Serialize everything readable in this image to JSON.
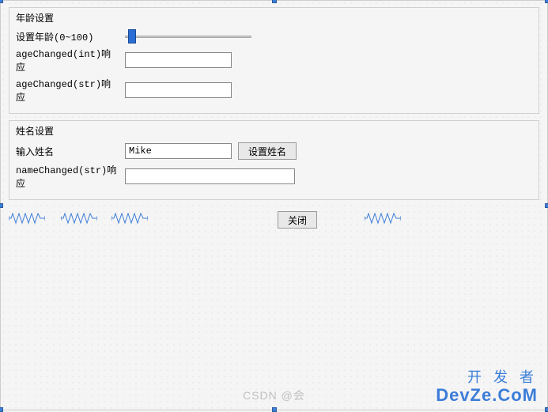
{
  "group_age": {
    "title": "年龄设置",
    "label_set_age": "设置年龄(0~100)",
    "slider": {
      "min": 0,
      "max": 100,
      "value": 5
    },
    "label_int_resp": "ageChanged(int)响应",
    "input_int_resp": "",
    "label_str_resp": "ageChanged(str)响应",
    "input_str_resp": ""
  },
  "group_name": {
    "title": "姓名设置",
    "label_input_name": "输入姓名",
    "input_name_value": "Mike",
    "btn_set_name": "设置姓名",
    "label_name_resp": "nameChanged(str)响应",
    "input_name_resp": ""
  },
  "close_button": "关闭",
  "watermarks": {
    "csdn": "CSDN @会",
    "devze_line1": "开 发 者",
    "devze_line2": "DevZe.CoM"
  }
}
